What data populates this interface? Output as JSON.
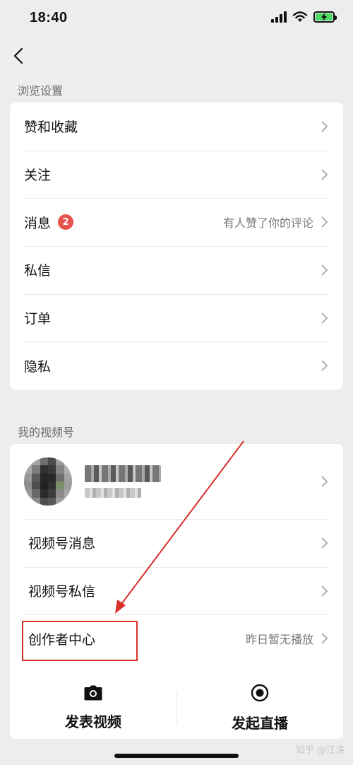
{
  "status": {
    "time": "18:40"
  },
  "browse_section": {
    "title": "浏览设置",
    "items": [
      {
        "label": "赞和收藏"
      },
      {
        "label": "关注"
      },
      {
        "label": "消息",
        "badge": "2",
        "value": "有人赞了你的评论"
      },
      {
        "label": "私信"
      },
      {
        "label": "订单"
      },
      {
        "label": "隐私"
      }
    ]
  },
  "channels_section": {
    "title": "我的视频号",
    "items": [
      {
        "label": "视频号消息"
      },
      {
        "label": "视频号私信"
      },
      {
        "label": "创作者中心",
        "value": "昨日暂无播放"
      }
    ]
  },
  "actions": [
    {
      "label": "发表视频",
      "icon": "camera-icon"
    },
    {
      "label": "发起直播",
      "icon": "live-record-icon"
    }
  ],
  "watermark": "知乎 @江涛",
  "colors": {
    "badge": "#e5534b",
    "annotation": "#d9302a",
    "battery": "#4cd964"
  }
}
